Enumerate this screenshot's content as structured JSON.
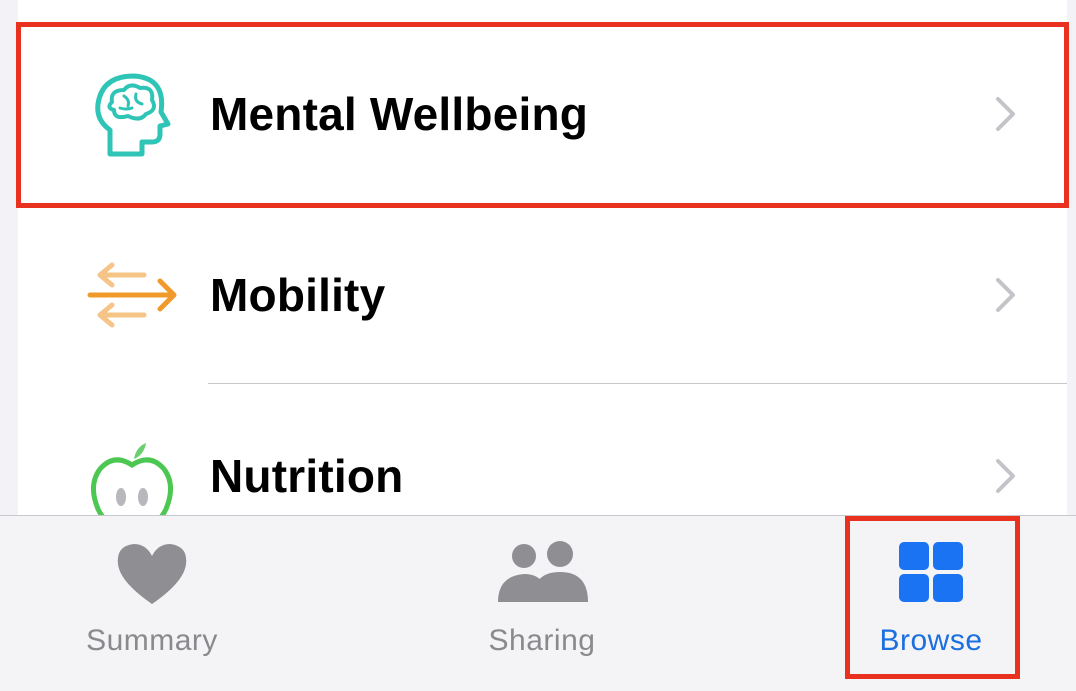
{
  "list": {
    "items": [
      {
        "label": "Mental Wellbeing",
        "icon": "brain-head-icon",
        "color": "#2ec4b6"
      },
      {
        "label": "Mobility",
        "icon": "mobility-arrows-icon",
        "color": "#f09a2b"
      },
      {
        "label": "Nutrition",
        "icon": "apple-icon",
        "color": "#4cc752"
      }
    ]
  },
  "tabbar": {
    "tabs": [
      {
        "label": "Summary",
        "icon": "heart-icon",
        "selected": false
      },
      {
        "label": "Sharing",
        "icon": "people-icon",
        "selected": false
      },
      {
        "label": "Browse",
        "icon": "grid-icon",
        "selected": true
      }
    ]
  },
  "colors": {
    "accent": "#1b6fe0",
    "highlight": "#e8311f",
    "inactive": "#8a8a8e"
  }
}
